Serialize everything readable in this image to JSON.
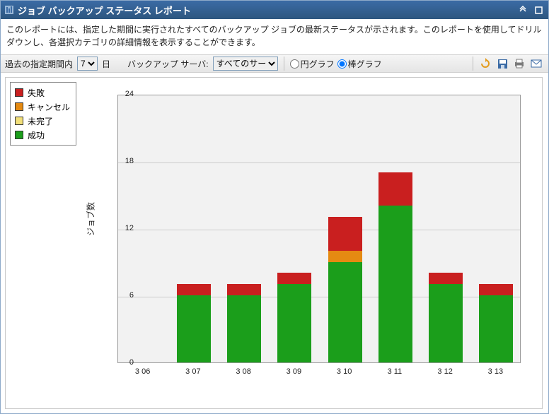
{
  "title": "ジョブ バックアップ ステータス レポート",
  "description": "このレポートには、指定した期間に実行されたすべてのバックアップ ジョブの最新ステータスが示されます。このレポートを使用してドリルダウンし、各選択カテゴリの詳細情報を表示することができます。",
  "toolbar": {
    "period_label": "過去の指定期間内",
    "period_value": "7",
    "period_unit": "日",
    "server_label": "バックアップ サーバ:",
    "server_value": "すべてのサーバ",
    "chart_type_pie": "円グラフ",
    "chart_type_bar": "棒グラフ"
  },
  "legend": {
    "fail": "失敗",
    "cancel": "キャンセル",
    "incomplete": "未完了",
    "success": "成功"
  },
  "colors": {
    "fail": "#c91f1f",
    "cancel": "#e58a12",
    "incomplete": "#f2df7a",
    "success": "#1b9e1b",
    "grid": "#cccccc",
    "plot_bg": "#f2f2f2"
  },
  "ylabel": "ジョブ数",
  "chart_data": {
    "type": "bar",
    "categories": [
      "3 06",
      "3 07",
      "3 08",
      "3 09",
      "3 10",
      "3 11",
      "3 12",
      "3 13"
    ],
    "series": [
      {
        "name": "成功",
        "key": "success",
        "values": [
          0,
          6,
          6,
          7,
          9,
          14,
          7,
          6
        ]
      },
      {
        "name": "未完了",
        "key": "incomplete",
        "values": [
          0,
          0,
          0,
          0,
          0,
          0,
          0,
          0
        ]
      },
      {
        "name": "キャンセル",
        "key": "cancel",
        "values": [
          0,
          0,
          0,
          0,
          1,
          0,
          0,
          0
        ]
      },
      {
        "name": "失敗",
        "key": "fail",
        "values": [
          0,
          1,
          1,
          1,
          3,
          3,
          1,
          1
        ]
      }
    ],
    "ylim": [
      0,
      24
    ],
    "yticks": [
      0,
      6,
      12,
      18,
      24
    ]
  }
}
